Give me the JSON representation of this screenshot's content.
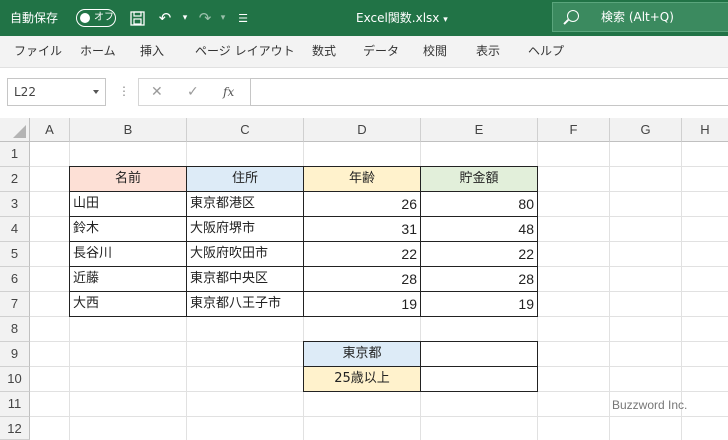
{
  "titlebar": {
    "autosave_label": "自動保存",
    "autosave_state": "オフ",
    "filename": "Excel関数.xlsx",
    "search_placeholder": "検索 (Alt+Q)",
    "accent_color": "#217346"
  },
  "menu": [
    "ファイル",
    "ホーム",
    "挿入",
    "ページ レイアウト",
    "数式",
    "データ",
    "校閲",
    "表示",
    "ヘルプ"
  ],
  "formula_bar": {
    "name_box": "L22",
    "cancel_icon": "✕",
    "enter_icon": "✓",
    "fx_label": "fx",
    "formula": ""
  },
  "columns": [
    "A",
    "B",
    "C",
    "D",
    "E",
    "F",
    "G",
    "H"
  ],
  "rows": [
    "1",
    "2",
    "3",
    "4",
    "5",
    "6",
    "7",
    "8",
    "9",
    "10",
    "11",
    "12"
  ],
  "table": {
    "headers": [
      {
        "text": "名前",
        "color": "#fde0d6"
      },
      {
        "text": "住所",
        "color": "#ddebf7"
      },
      {
        "text": "年齢",
        "color": "#fff2cc"
      },
      {
        "text": "貯金額",
        "color": "#e2efda"
      }
    ],
    "rows": [
      [
        "山田",
        "東京都港区",
        "26",
        "80"
      ],
      [
        "鈴木",
        "大阪府堺市",
        "31",
        "48"
      ],
      [
        "長谷川",
        "大阪府吹田市",
        "22",
        "22"
      ],
      [
        "近藤",
        "東京都中央区",
        "28",
        "28"
      ],
      [
        "大西",
        "東京都八王子市",
        "19",
        "19"
      ]
    ]
  },
  "criteria": [
    {
      "label": "東京都",
      "color": "#ddebf7",
      "value": ""
    },
    {
      "label": "25歳以上",
      "color": "#fff2cc",
      "value": ""
    }
  ],
  "watermark": "Buzzword Inc."
}
